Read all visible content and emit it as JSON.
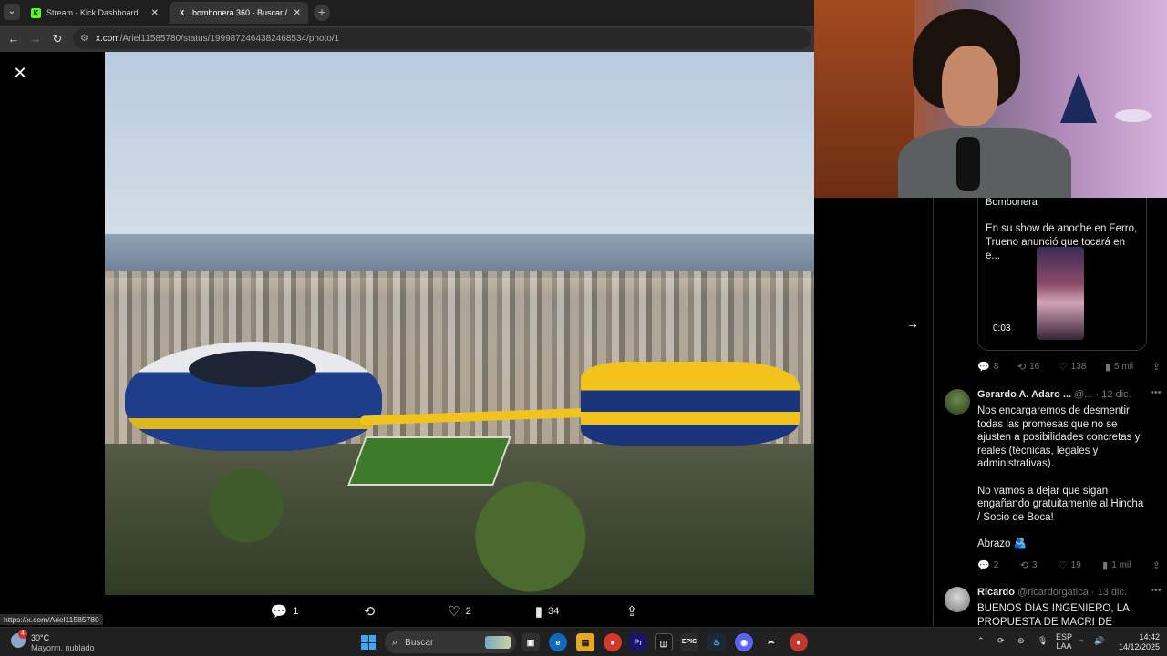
{
  "browser": {
    "tabs": [
      {
        "title": "Stream - Kick Dashboard",
        "favicon": "K",
        "active": false
      },
      {
        "title": "bombonera 360 - Buscar / X",
        "favicon": "X",
        "active": true
      }
    ],
    "url_host": "x.com",
    "url_path": "/Ariel11585780/status/1999872464382468534/photo/1",
    "status_url": "https://x.com/Ariel11585780"
  },
  "tweet_actions": {
    "replies": "1",
    "reposts": "",
    "likes": "2",
    "views": "34"
  },
  "quoted": {
    "title": "Bombonera",
    "body": "En su show de anoche en Ferro, Trueno anunció que tocará en e...",
    "duration": "0:03",
    "metrics": {
      "replies": "8",
      "reposts": "16",
      "likes": "138",
      "views": "5 mil"
    }
  },
  "replies": [
    {
      "name": "Gerardo A. Adaro ...",
      "handle": "@...",
      "date": "· 12 dic.",
      "body": "Nos encargaremos de desmentir todas las promesas que no se ajusten a posibilidades concretas y reales (técnicas, legales y administrativas).\n\nNo vamos a dejar que sigan engañando gratuitamente al Hincha / Socio de Boca!\n\nAbrazo 🫂",
      "metrics": {
        "replies": "2",
        "reposts": "3",
        "likes": "19",
        "views": "1 mil"
      }
    },
    {
      "name": "Ricardo",
      "handle": "@ricardorgatica",
      "date": "· 13 dic.",
      "body": "BUENOS DIAS INGENIERO, LA PROPUESTA DE MACRI DE HACER"
    }
  ],
  "taskbar": {
    "weather_temp": "30°C",
    "weather_cond": "Mayorm. nublado",
    "weather_badge": "4",
    "search_placeholder": "Buscar",
    "lang": "ESP",
    "lang_sub": "LAA",
    "time": "14:42",
    "date": "14/12/2025"
  },
  "colors": {
    "accent_blue": "#1d9bf0",
    "boca_blue": "#1a357c",
    "boca_gold": "#f2c31c",
    "muted": "#71767b"
  }
}
